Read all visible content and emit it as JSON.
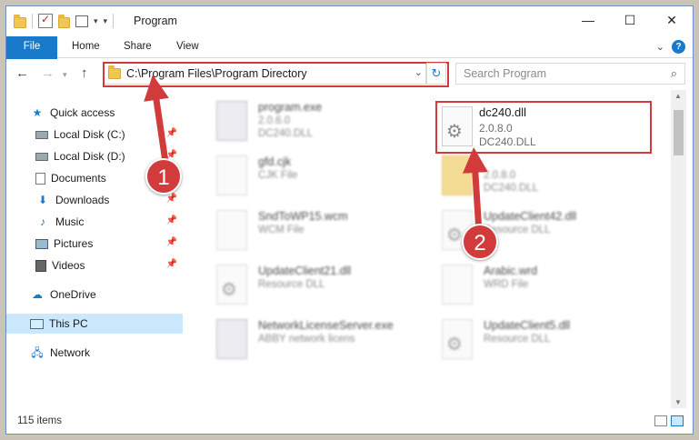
{
  "window": {
    "title": "Program",
    "controls": {
      "minimize": "—",
      "maximize": "☐",
      "close": "✕"
    }
  },
  "ribbon": {
    "tabs": [
      "File",
      "Home",
      "Share",
      "View"
    ]
  },
  "navigation": {
    "address": "C:\\Program Files\\Program Directory",
    "search_placeholder": "Search Program"
  },
  "sidebar": {
    "items": [
      {
        "label": "Quick access",
        "icon": "star-icon"
      },
      {
        "label": "Local Disk (C:)",
        "icon": "drive-icon",
        "pinned": true
      },
      {
        "label": "Local Disk (D:)",
        "icon": "drive-icon",
        "pinned": true
      },
      {
        "label": "Documents",
        "icon": "documents-icon",
        "pinned": true
      },
      {
        "label": "Downloads",
        "icon": "downloads-icon",
        "pinned": true
      },
      {
        "label": "Music",
        "icon": "music-icon",
        "pinned": true
      },
      {
        "label": "Pictures",
        "icon": "pictures-icon",
        "pinned": true
      },
      {
        "label": "Videos",
        "icon": "videos-icon",
        "pinned": true
      },
      {
        "label": "OneDrive",
        "icon": "cloud-icon"
      },
      {
        "label": "This PC",
        "icon": "computer-icon",
        "selected": true
      },
      {
        "label": "Network",
        "icon": "network-icon"
      }
    ]
  },
  "files": {
    "target": {
      "name": "dc240.dll",
      "version": "2.0.8.0",
      "description": "DC240.DLL"
    },
    "background": [
      {
        "name": "program.exe",
        "line1": "2.0.6.0",
        "line2": "DC240.DLL",
        "kind": "exe"
      },
      {
        "name": "gfd.cjk",
        "line1": "CJK File",
        "line2": "",
        "kind": "doc"
      },
      {
        "name": "",
        "line1": "2.0.8.0",
        "line2": "DC240.DLL",
        "kind": "folder"
      },
      {
        "name": "SndToWP15.wcm",
        "line1": "WCM File",
        "line2": "",
        "kind": "doc"
      },
      {
        "name": "UpdateClient42.dll",
        "line1": "Resource DLL",
        "line2": "",
        "kind": "gear"
      },
      {
        "name": "UpdateClient21.dll",
        "line1": "Resource DLL",
        "line2": "",
        "kind": "gear"
      },
      {
        "name": "Arabic.wrd",
        "line1": "WRD File",
        "line2": "",
        "kind": "doc"
      },
      {
        "name": "NetworkLicenseServer.exe",
        "line1": "ABBY network licens",
        "line2": "",
        "kind": "exe"
      },
      {
        "name": "UpdateClient5.dll",
        "line1": "Resource DLL",
        "line2": "",
        "kind": "gear"
      }
    ]
  },
  "status": {
    "item_count": "115 items"
  },
  "annotations": {
    "step1": "1",
    "step2": "2",
    "color": "#d23b3b"
  }
}
